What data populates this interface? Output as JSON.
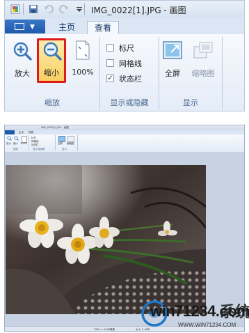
{
  "title": "IMG_0022[1].JPG - 画图",
  "tabs": {
    "home": "主页",
    "view": "查看"
  },
  "zoom_group": {
    "label": "缩放",
    "zoom_in": "放大",
    "zoom_out": "缩小",
    "actual_size": "100%"
  },
  "show_hide_group": {
    "label": "显示或隐藏",
    "ruler": "标尺",
    "gridlines": "网格线",
    "statusbar": "状态栏",
    "ruler_checked": false,
    "gridlines_checked": false,
    "statusbar_checked": true
  },
  "display_group": {
    "label": "显示",
    "fullscreen": "全屏",
    "thumbnail": "缩略图"
  },
  "statusbar": {
    "dimensions": "3264 × 2448像素",
    "size": "大小: 2.0MB"
  },
  "watermark": {
    "text": "win71234.com",
    "sub": "WWW.WIN71234.COM",
    "brand": "系统"
  },
  "colors": {
    "ribbon": "#e4ecf7",
    "highlight": "#f9d063",
    "red_box": "#e11a1a",
    "accent_blue": "#1e5aab"
  }
}
